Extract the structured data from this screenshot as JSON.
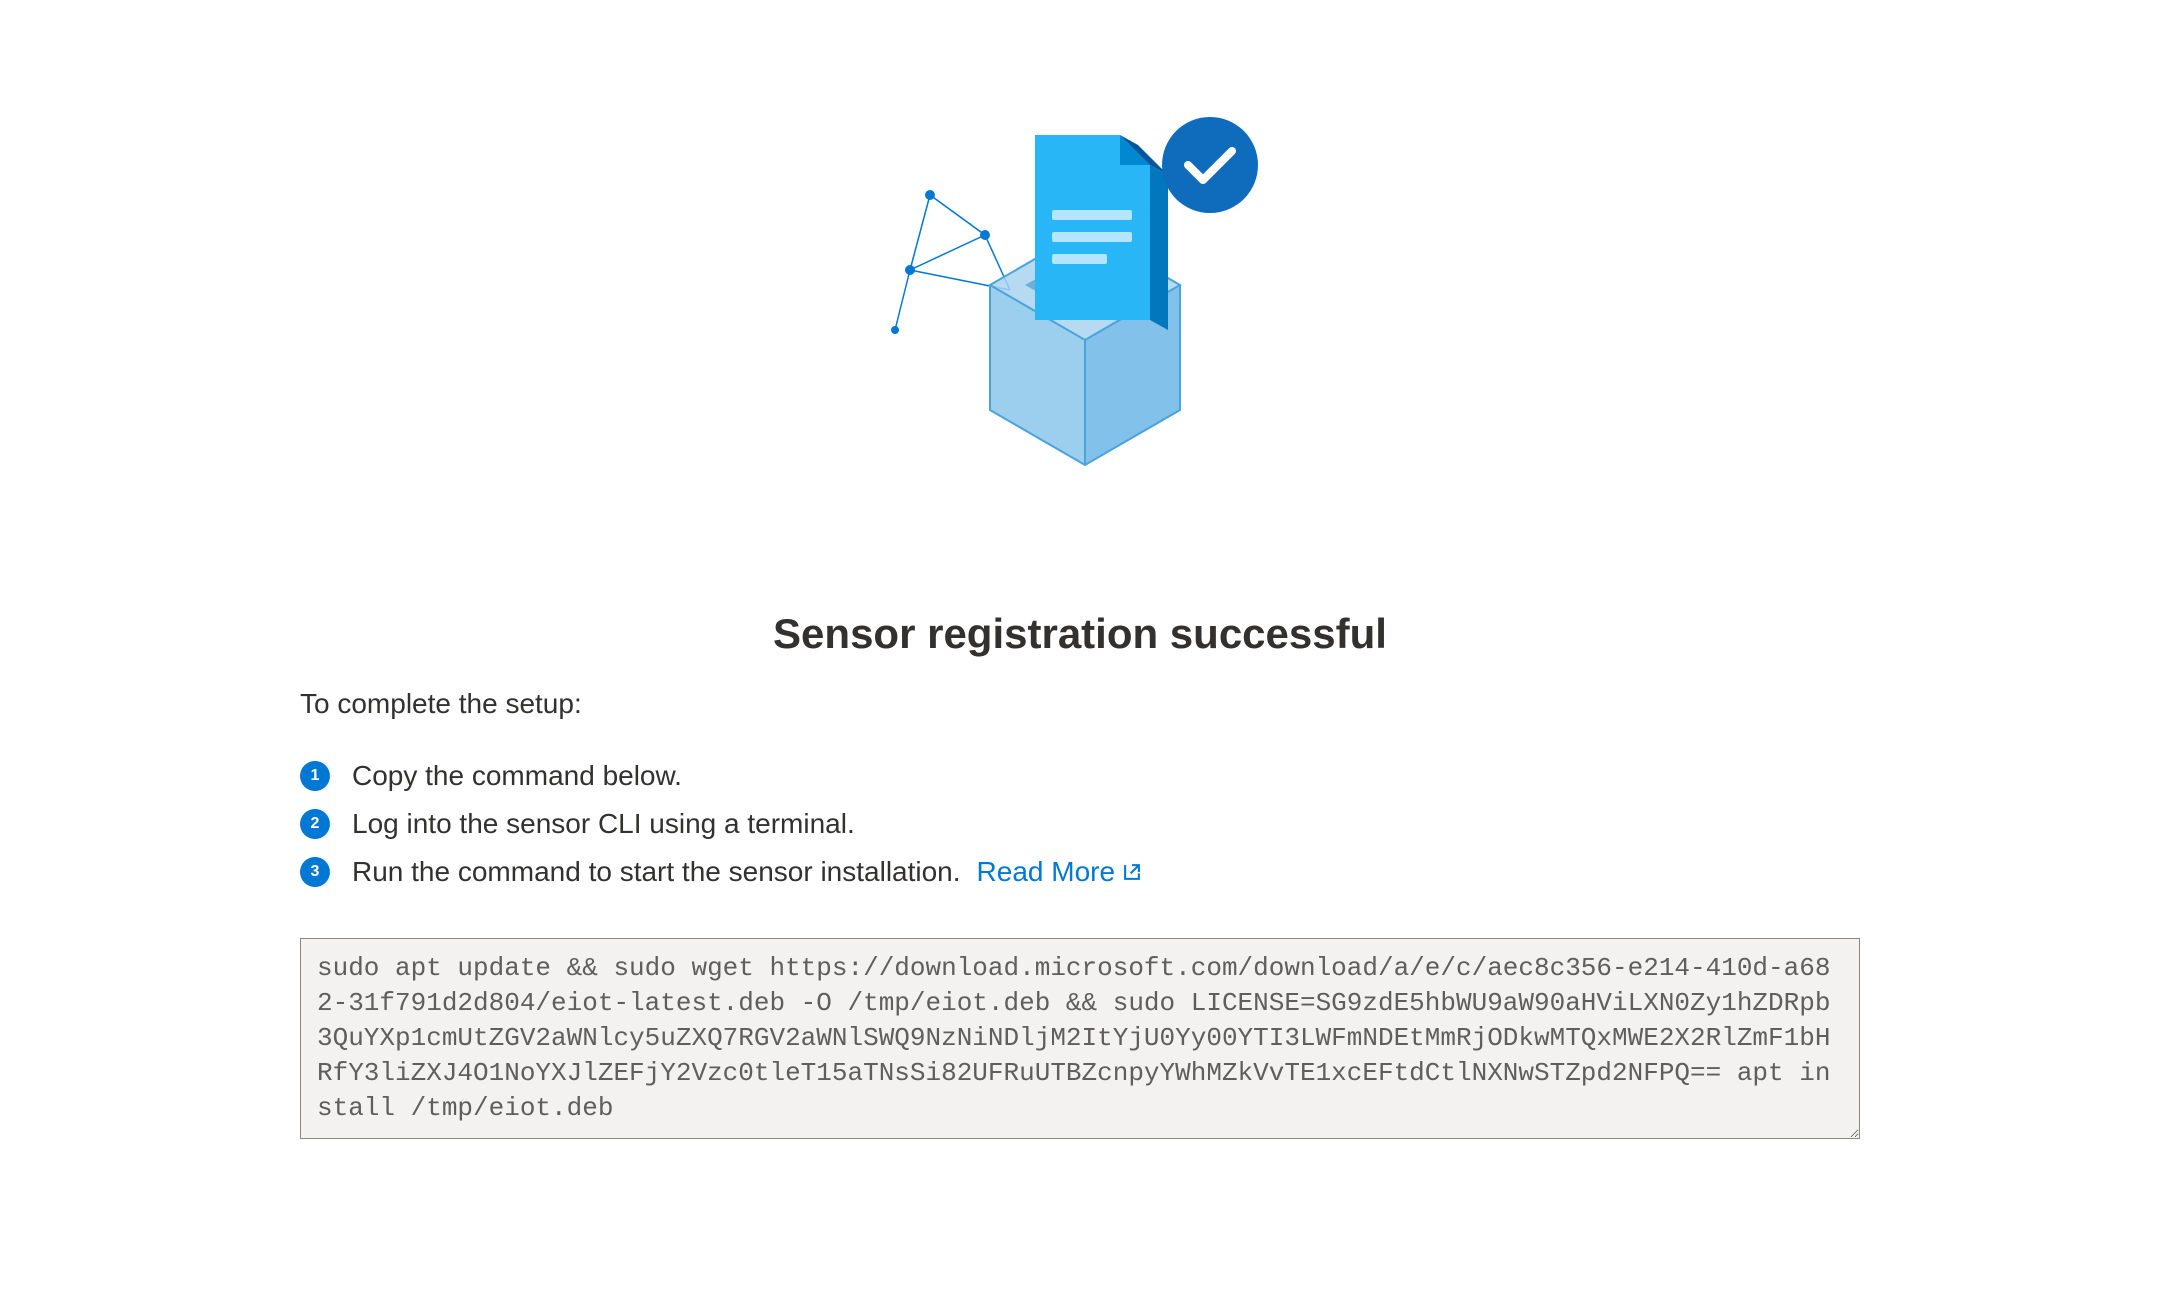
{
  "title": "Sensor registration successful",
  "subtitle": "To complete the setup:",
  "steps": [
    {
      "number": "1",
      "text": "Copy the command below."
    },
    {
      "number": "2",
      "text": "Log into the sensor CLI using a terminal."
    },
    {
      "number": "3",
      "text": "Run the command to start the sensor installation."
    }
  ],
  "readMore": "Read More",
  "command": "sudo apt update && sudo wget https://download.microsoft.com/download/a/e/c/aec8c356-e214-410d-a682-31f791d2d804/eiot-latest.deb -O /tmp/eiot.deb && sudo LICENSE=SG9zdE5hbWU9aW90aHViLXN0Zy1hZDRpb3QuYXp1cmUtZGV2aWNlcy5uZXQ7RGV2aWNlSWQ9NzNiNDljM2ItYjU0Yy00YTI3LWFmNDEtMmRjODkwMTQxMWE2X2RlZmF1bHRfY3liZXJ4O1NoYXJlZEFjY2Vzc0tleT15aTNsSi82UFRuUTBZcnpyYWhMZkVvTE1xcEFtdCtlNXNwSTZpd2NFPQ== apt install /tmp/eiot.deb",
  "colors": {
    "primary": "#0078d4",
    "successBadge": "#0f6cbd"
  }
}
